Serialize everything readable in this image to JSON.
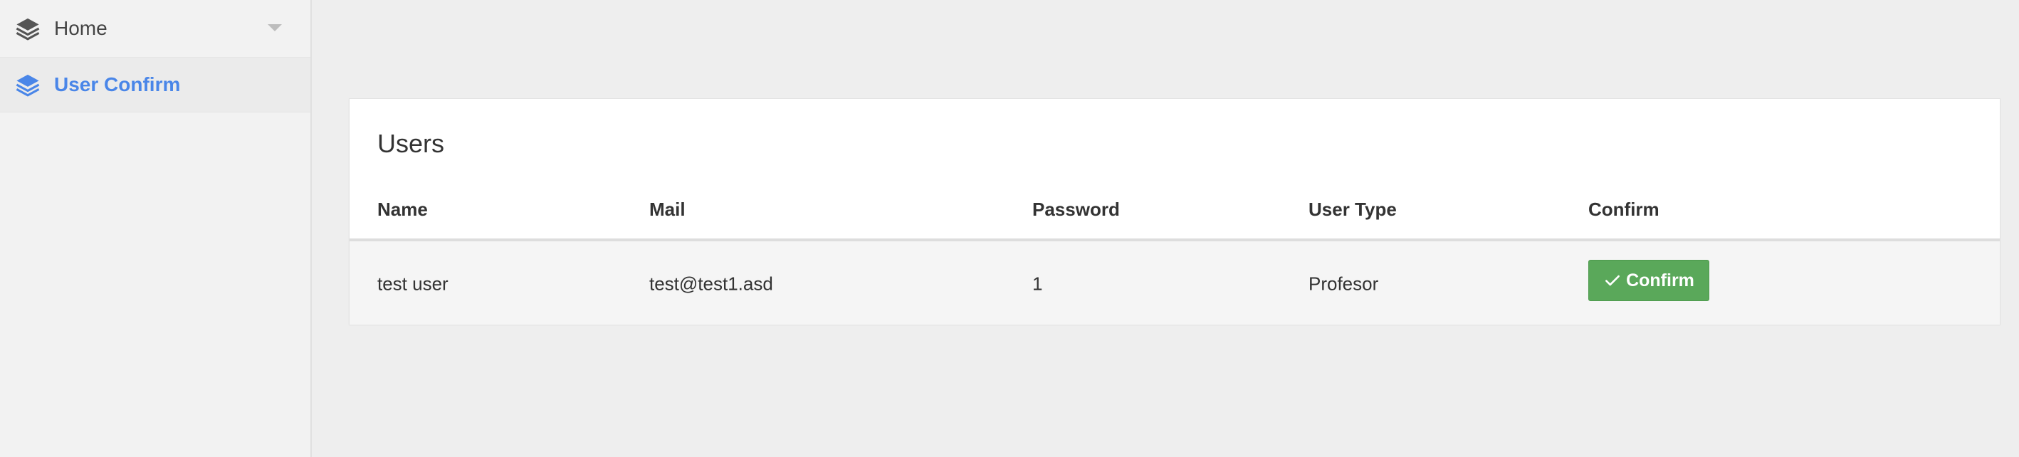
{
  "sidebar": {
    "items": [
      {
        "label": "Home",
        "icon": "layers-icon",
        "has_dropdown": true,
        "active": false
      },
      {
        "label": "User Confirm",
        "icon": "layers-icon",
        "active": true
      }
    ]
  },
  "card": {
    "title": "Users",
    "columns": [
      "Name",
      "Mail",
      "Password",
      "User Type",
      "Confirm"
    ],
    "rows": [
      {
        "name": "test user",
        "mail": "test@test1.asd",
        "password": "1",
        "user_type": "Profesor",
        "action_label": "Confirm"
      }
    ]
  },
  "colors": {
    "accent": "#4a86e8",
    "confirm_button": "#5aa85a",
    "page_background": "#eeeeee",
    "sidebar_background": "#f2f2f2"
  }
}
